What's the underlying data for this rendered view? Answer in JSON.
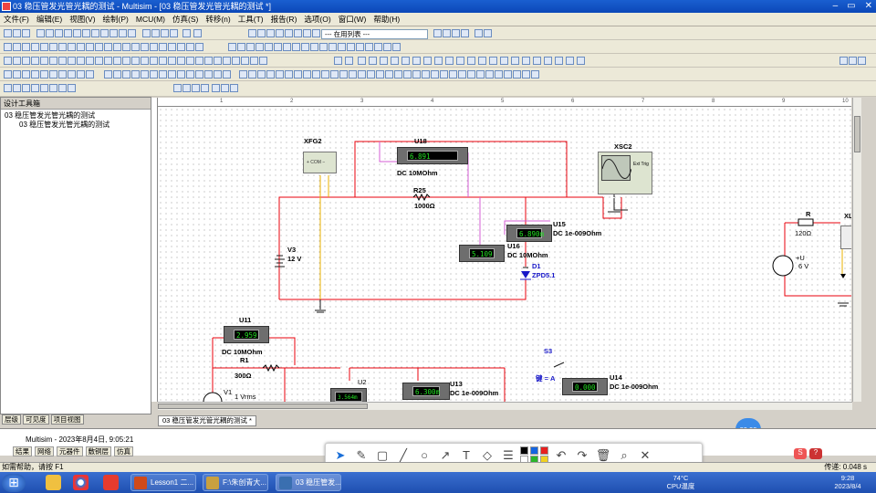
{
  "window": {
    "title": "03 稳压管发光管光耦的测试 - Multisim - [03 稳压管发光管光耦的测试 *]",
    "controls": [
      "–",
      "▭",
      "✕"
    ]
  },
  "menu": [
    "文件(F)",
    "编辑(E)",
    "视图(V)",
    "绘制(P)",
    "MCU(M)",
    "仿真(S)",
    "转移(n)",
    "工具(T)",
    "报告(R)",
    "选项(O)",
    "窗口(W)",
    "帮助(H)"
  ],
  "toolbar": {
    "inuse_list": "--- 在用列表 ---"
  },
  "design_toolbox": {
    "title": "设计工具箱",
    "root": "03 稳压管发光管光耦的测试",
    "child": "03 稳压管发光管光耦的测试",
    "tabs": [
      "层级",
      "可见度",
      "项目视图"
    ]
  },
  "ruler": [
    "1",
    "2",
    "3",
    "4",
    "5",
    "6",
    "7",
    "8",
    "9",
    "10"
  ],
  "components": {
    "xfg2": "XFG2",
    "xsc2": "XSC2",
    "ext_trig": "Ext Trig",
    "u18": {
      "ref": "U18",
      "value": "6.891",
      "mode": "DC  10MOhm"
    },
    "r25": {
      "ref": "R25",
      "value": "1000Ω"
    },
    "u15": {
      "ref": "U15",
      "value": "6.890m",
      "mode": "DC  1e-009Ohm"
    },
    "u16": {
      "ref": "U16",
      "value": "5.109",
      "mode": "DC  10MOhm"
    },
    "d1": {
      "ref": "D1",
      "value": "ZPD5.1"
    },
    "v3": {
      "ref": "V3",
      "value": "12 V"
    },
    "r_right": {
      "ref": "R",
      "value": "120Ω"
    },
    "u_right": {
      "ref": "+U",
      "value": "6 V"
    },
    "xl": "XL",
    "u11": {
      "ref": "U11",
      "value": "2.959",
      "mode": "DC  10MOhm"
    },
    "r1": {
      "ref": "R1",
      "value": "300Ω"
    },
    "v1": {
      "ref": "V1",
      "value": "1 Vrms"
    },
    "u2": {
      "ref": "U2",
      "value": "3.564m"
    },
    "u13": {
      "ref": "U13",
      "value": "6.300m",
      "mode": "DC  1e-009Ohm"
    },
    "s3": {
      "ref": "S3",
      "key": "键 = A"
    },
    "u14": {
      "ref": "U14",
      "value": "0.000",
      "mode": "DC  1e-009Ohm"
    }
  },
  "doc_tab": "03 稳压管发光管光耦的测试 *",
  "status": {
    "line": "Multisim  -  2023年8月4日, 9:05:21",
    "tabs": [
      "结果",
      "网络",
      "元器件",
      "敷铜层",
      "仿真"
    ],
    "help": "如需帮助，请按 F1",
    "sim_time": "传递: 0.048 s"
  },
  "timer": "00:00",
  "taskbar": {
    "items": [
      "Lesson1 二...",
      "F:\\朱创青大...",
      "03 稳压管发..."
    ],
    "temp": "74°C",
    "cpu": "CPU温度",
    "time": "9:28",
    "date": "2023/8/4"
  }
}
